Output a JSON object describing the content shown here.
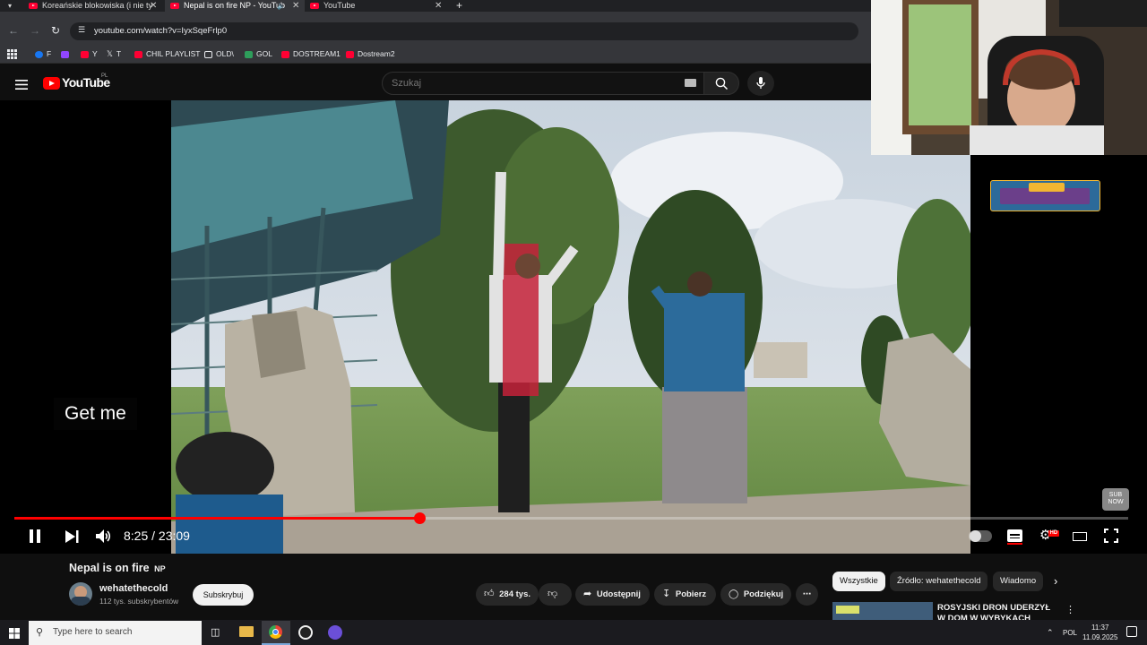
{
  "browser": {
    "tabs": [
      {
        "title": "Koreańskie blokowiska (i nie ty",
        "active": false
      },
      {
        "title": "Nepal is on fire NP - YouTub",
        "active": true
      },
      {
        "title": "YouTube",
        "active": false
      }
    ],
    "new_tab": "+",
    "url": "youtube.com/watch?v=IyxSqeFrlp0",
    "bookmarks": [
      "F",
      "Y",
      "T",
      "CHIL PLAYLIST",
      "OLD\\",
      "GOL",
      "DOSTREAM1",
      "Dostream2"
    ]
  },
  "youtube": {
    "logo": "YouTube",
    "region": "PL",
    "search_placeholder": "Szukaj"
  },
  "player": {
    "caption": "Get me",
    "time": "8:25 / 23:09",
    "progress_fraction": 0.364,
    "hd_badge": "HD",
    "corner_badge": "SUB NOW"
  },
  "video": {
    "title": "Nepal is on fire",
    "title_flag": "NP",
    "channel": "wehatethecold",
    "subscribers": "112 tys. subskrybentów",
    "subscribe_label": "Subskrybuj",
    "likes": "284 tys.",
    "share_label": "Udostępnij",
    "download_label": "Pobierz",
    "thanks_label": "Podziękuj"
  },
  "sidebar": {
    "chips": [
      "Wszystkie",
      "Źródło: wehatethecold",
      "Wiadomo"
    ],
    "next_video_title": "ROSYJSKI DRON UDERZYŁ W DOM W WYBYKACH"
  },
  "taskbar": {
    "search_placeholder": "Type here to search",
    "language": "POL",
    "time": "11:37",
    "date": "11.09.2025"
  },
  "colors": {
    "yt_red": "#ff0000",
    "background": "#0f0f0f"
  }
}
